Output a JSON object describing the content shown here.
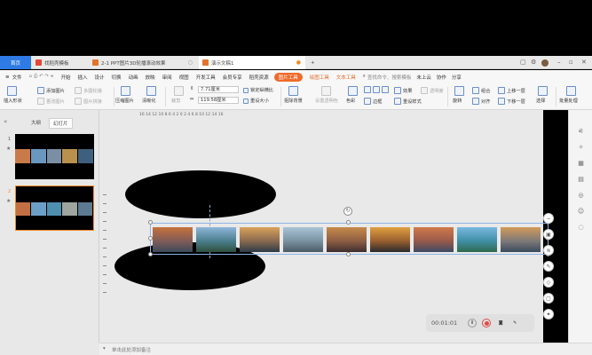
{
  "tabs": {
    "home": "首页",
    "t1": "找稻壳模板",
    "t2": "2-1 PPT图片3D轮播滚动效果",
    "t3": "演示文稿1",
    "add": "+"
  },
  "menu": {
    "file": "文件",
    "items": [
      "开始",
      "插入",
      "设计",
      "切换",
      "动画",
      "放映",
      "审阅",
      "视图",
      "开发工具",
      "会员专享",
      "稻壳资源"
    ],
    "pic_tools": "图片工具",
    "draw_tools": "绘图工具",
    "text_tools": "文本工具",
    "search": "查找命令、搜索模板",
    "cloud": "未上云",
    "collab": "协作",
    "share": "分享"
  },
  "ribbon": {
    "insert_shape": "插入形状",
    "add_picture": "添加图片",
    "multi_crop": "多图轮播",
    "replace_picture": "更改图片",
    "picture_stitch": "图片拼接",
    "compress": "压缩图片",
    "sharpen": "清晰化",
    "crop": "裁剪",
    "width": "7.71厘米",
    "height": "119.58厘米",
    "lock_ratio": "锁定纵横比",
    "reset_size": "重设大小",
    "cutout": "抠除背景",
    "set_transparent": "设置透明色",
    "color": "色彩",
    "effect": "效果",
    "transparency": "透明度",
    "border": "边框",
    "reset_style": "重设样式",
    "combine": "组合",
    "rotate": "旋转",
    "align": "对齐",
    "bring_up": "上移一层",
    "send_down": "下移一层",
    "select": "选择",
    "batch": "批量处理"
  },
  "left_panel": {
    "tab_outline": "大纲",
    "tab_slides": "幻灯片",
    "slide1_num": "1",
    "slide2_num": "2",
    "add": "+"
  },
  "ruler": "16   14   12   10    8    6    4    2    0    2    4    6    8   10   12   14   16",
  "recorder": {
    "time": "00:01:01"
  },
  "notes": "单击此处添加备注",
  "colors": {
    "accent": "#2f7be5",
    "orange": "#f08a24",
    "pic_tools_pill": "#f06a2a"
  }
}
